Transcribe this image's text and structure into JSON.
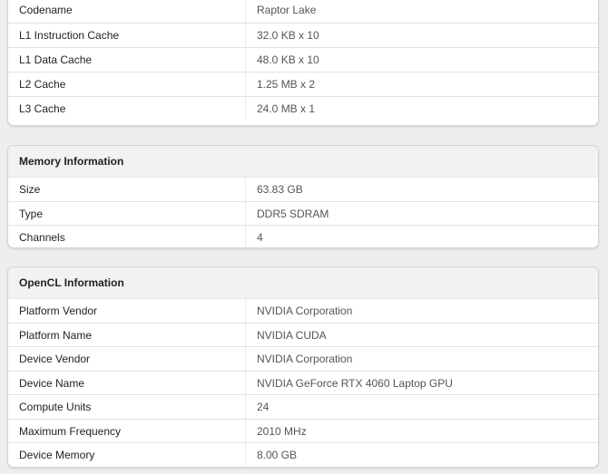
{
  "cpu": {
    "rows": [
      {
        "label": "Codename",
        "value": "Raptor Lake"
      },
      {
        "label": "L1 Instruction Cache",
        "value": "32.0 KB x 10"
      },
      {
        "label": "L1 Data Cache",
        "value": "48.0 KB x 10"
      },
      {
        "label": "L2 Cache",
        "value": "1.25 MB x 2"
      },
      {
        "label": "L3 Cache",
        "value": "24.0 MB x 1"
      }
    ]
  },
  "memory": {
    "title": "Memory Information",
    "rows": [
      {
        "label": "Size",
        "value": "63.83 GB"
      },
      {
        "label": "Type",
        "value": "DDR5 SDRAM"
      },
      {
        "label": "Channels",
        "value": "4"
      }
    ]
  },
  "opencl": {
    "title": "OpenCL Information",
    "rows": [
      {
        "label": "Platform Vendor",
        "value": "NVIDIA Corporation"
      },
      {
        "label": "Platform Name",
        "value": "NVIDIA CUDA"
      },
      {
        "label": "Device Vendor",
        "value": "NVIDIA Corporation"
      },
      {
        "label": "Device Name",
        "value": "NVIDIA GeForce RTX 4060 Laptop GPU"
      },
      {
        "label": "Compute Units",
        "value": "24"
      },
      {
        "label": "Maximum Frequency",
        "value": "2010 MHz"
      },
      {
        "label": "Device Memory",
        "value": "8.00 GB"
      }
    ]
  }
}
